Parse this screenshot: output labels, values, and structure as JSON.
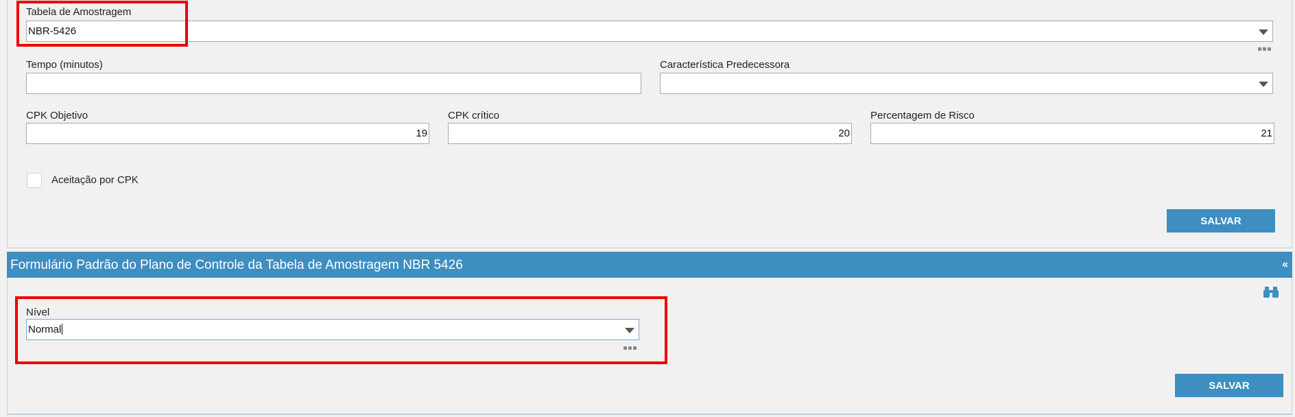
{
  "sampling": {
    "table_label": "Tabela de Amostragem",
    "table_value": "NBR-5426",
    "time_label": "Tempo (minutos)",
    "time_value": "",
    "predecessor_label": "Característica Predecessora",
    "predecessor_value": ""
  },
  "cpk": {
    "objective_label": "CPK Objetivo",
    "objective_value": "19",
    "critical_label": "CPK crítico",
    "critical_value": "20",
    "risk_label": "Percentagem de Risco",
    "risk_value": "21"
  },
  "acceptance": {
    "label": "Aceitação por CPK",
    "checked": false
  },
  "buttons": {
    "save_top": "SALVAR",
    "save_bottom": "SALVAR"
  },
  "section": {
    "title": "Formulário Padrão do Plano de Controle da Tabela de Amostragem NBR 5426",
    "collapse_glyph": "«"
  },
  "level": {
    "label": "Nível",
    "value": "Normal"
  },
  "icons": {
    "dropdown": "chevron-down-icon",
    "more": "more-options-icon",
    "search": "binoculars-icon"
  },
  "colors": {
    "accent": "#3e8ec0",
    "highlight": "#ee0000"
  }
}
